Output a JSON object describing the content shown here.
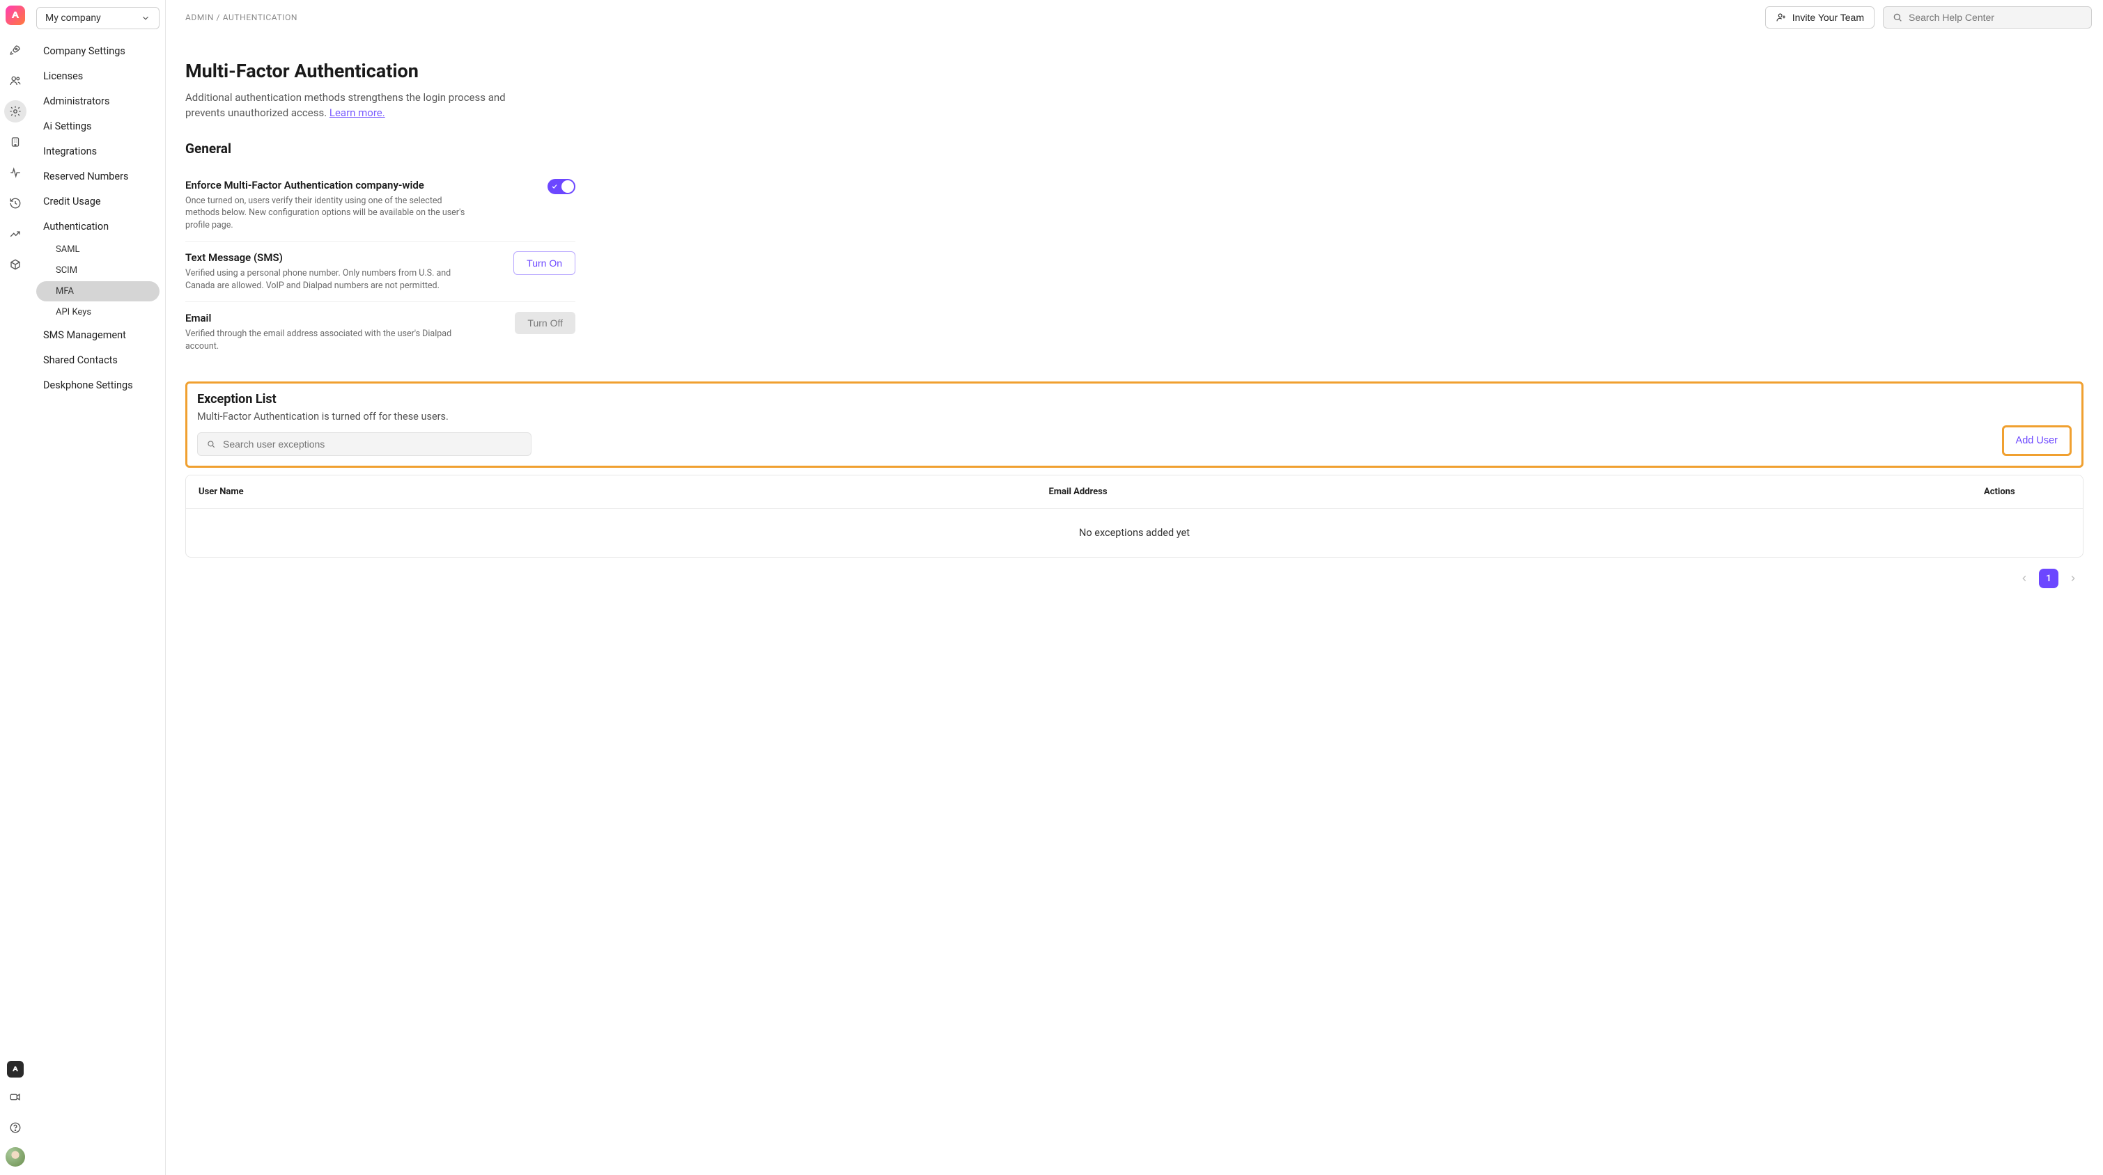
{
  "company_selector": {
    "label": "My company"
  },
  "breadcrumb": "ADMIN / AUTHENTICATION",
  "topbar": {
    "invite_label": "Invite Your Team",
    "search_placeholder": "Search Help Center"
  },
  "sidebar": {
    "items": [
      {
        "label": "Company Settings"
      },
      {
        "label": "Licenses"
      },
      {
        "label": "Administrators"
      },
      {
        "label": "Ai Settings"
      },
      {
        "label": "Integrations"
      },
      {
        "label": "Reserved Numbers"
      },
      {
        "label": "Credit Usage"
      },
      {
        "label": "Authentication"
      },
      {
        "label": "SMS Management"
      },
      {
        "label": "Shared Contacts"
      },
      {
        "label": "Deskphone Settings"
      }
    ],
    "auth_subitems": [
      {
        "label": "SAML"
      },
      {
        "label": "SCIM"
      },
      {
        "label": "MFA"
      },
      {
        "label": "API Keys"
      }
    ]
  },
  "page": {
    "title": "Multi-Factor Authentication",
    "subtitle_part1": "Additional authentication methods strengthens the login process and prevents unauthorized access. ",
    "learn_more": "Learn more."
  },
  "sections": {
    "general_title": "General",
    "enforce": {
      "label": "Enforce Multi-Factor Authentication company-wide",
      "desc": "Once turned on, users verify their identity using one of the selected methods below. New configuration options will be available on the user's profile page.",
      "state": "on"
    },
    "sms": {
      "label": "Text Message (SMS)",
      "desc": "Verified using a personal phone number. Only numbers from U.S. and Canada are allowed. VoIP and Dialpad numbers are not permitted.",
      "button": "Turn On"
    },
    "email": {
      "label": "Email",
      "desc": "Verified through the email address associated with the user's Dialpad account.",
      "button": "Turn Off"
    }
  },
  "exceptions": {
    "title": "Exception List",
    "desc": "Multi-Factor Authentication is turned off for these users.",
    "search_placeholder": "Search user exceptions",
    "add_user_label": "Add User",
    "columns": {
      "name": "User Name",
      "email": "Email Address",
      "actions": "Actions"
    },
    "empty_text": "No exceptions added yet",
    "page": "1"
  },
  "colors": {
    "brand": "#6c47ff",
    "highlight": "#f0a030"
  }
}
